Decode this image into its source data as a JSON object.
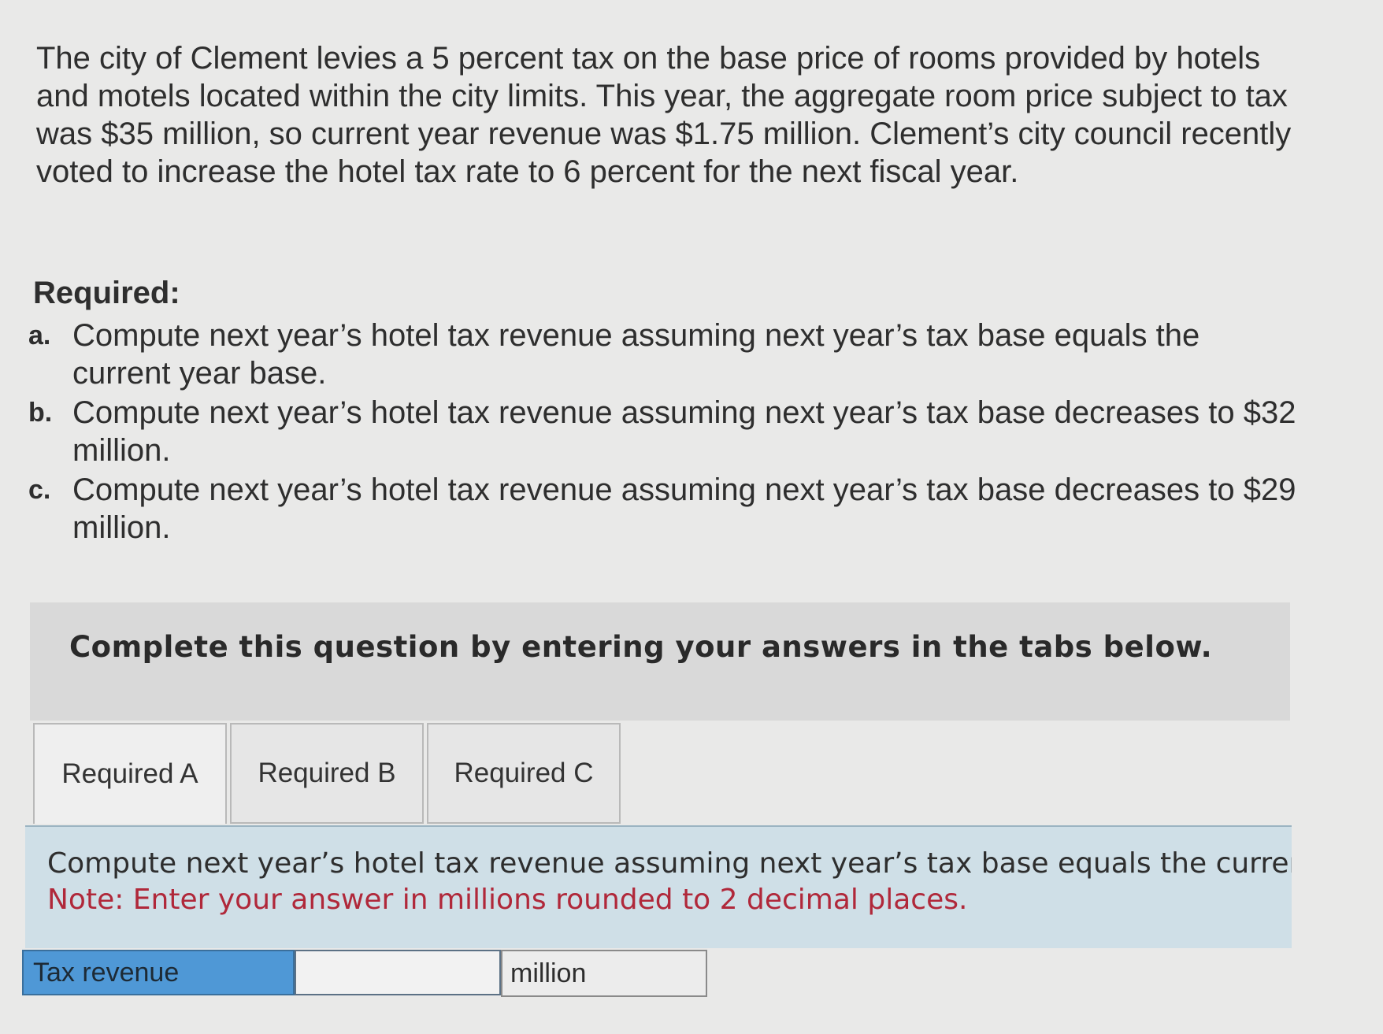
{
  "problem": {
    "intro": "The city of Clement levies a 5 percent tax on the base price of rooms provided by hotels and motels located within the city limits. This year, the aggregate room price subject to tax was $35 million, so current year revenue was $1.75 million. Clement’s city council recently voted to increase the hotel tax rate to 6 percent for the next fiscal year.",
    "required_heading": "Required:",
    "requirements": [
      {
        "marker": "a.",
        "text": "Compute next year’s hotel tax revenue assuming next year’s tax base equals the current year base."
      },
      {
        "marker": "b.",
        "text": "Compute next year’s hotel tax revenue assuming next year’s tax base decreases to $32 million."
      },
      {
        "marker": "c.",
        "text": "Compute next year’s hotel tax revenue assuming next year’s tax base decreases to $29 million."
      }
    ]
  },
  "instructions": "Complete this question by entering your answers in the tabs below.",
  "tabs": [
    {
      "label": "Required A",
      "active": true
    },
    {
      "label": "Required B",
      "active": false
    },
    {
      "label": "Required C",
      "active": false
    }
  ],
  "panel": {
    "question": "Compute next year’s hotel tax revenue assuming next year’s tax base equals the current ye",
    "note": "Note: Enter your answer in millions rounded to 2 decimal places."
  },
  "answer": {
    "label": "Tax revenue",
    "value": "",
    "unit": "million"
  }
}
